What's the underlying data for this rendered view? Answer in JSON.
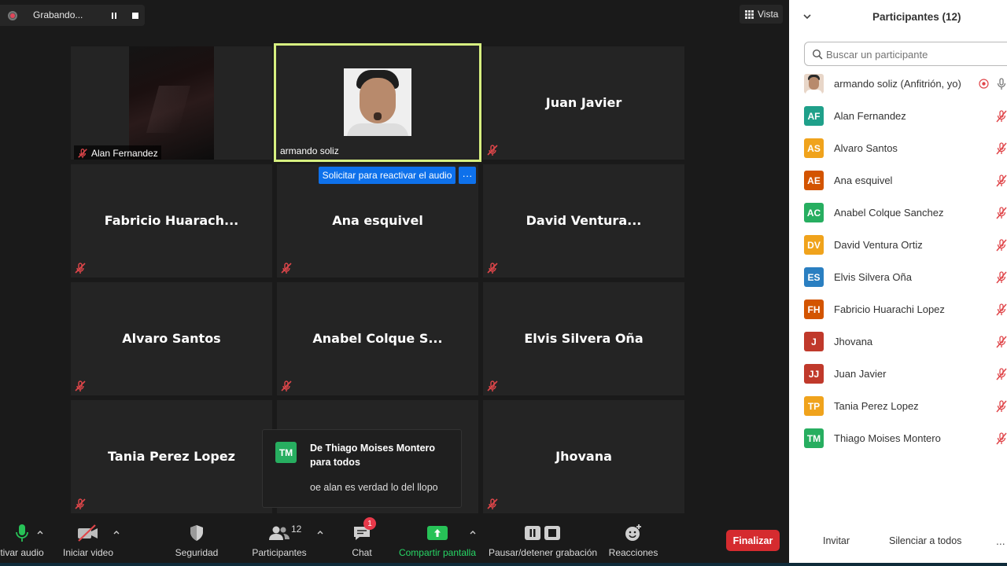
{
  "recording": {
    "label": "Grabando..."
  },
  "view_button": {
    "label": "Vista"
  },
  "tiles": [
    {
      "id": "alan",
      "name": "Alan Fernandez",
      "has_video": true
    },
    {
      "id": "armando",
      "name": "armando soliz",
      "has_video": true,
      "active_speaker": true
    },
    {
      "id": "juan",
      "name": "Juan Javier"
    },
    {
      "id": "fabricio",
      "name": "Fabricio  Huarach..."
    },
    {
      "id": "ana",
      "name": "Ana esquivel"
    },
    {
      "id": "david",
      "name": "David  Ventura..."
    },
    {
      "id": "alvaro",
      "name": "Alvaro Santos"
    },
    {
      "id": "anabel",
      "name": "Anabel  Colque  S..."
    },
    {
      "id": "elvis",
      "name": "Elvis Silvera Oña"
    },
    {
      "id": "tania",
      "name": "Tania Perez Lopez"
    },
    {
      "id": "jhovana",
      "name": "Jhovana"
    }
  ],
  "unmute_request": {
    "label": "Solicitar para reactivar el audio",
    "more_label": "···"
  },
  "chat_toast": {
    "initials": "TM",
    "from": "De Thiago Moises Montero para todos",
    "message": "oe alan es verdad lo del llopo",
    "avatar_color": "#27ae60"
  },
  "toolbar": {
    "audio_label": "tivar audio",
    "video_label": "Iniciar video",
    "security_label": "Seguridad",
    "participants_label": "Participantes",
    "participants_count": "12",
    "chat_label": "Chat",
    "chat_badge": "1",
    "share_label": "Compartir pantalla",
    "record_label": "Pausar/detener grabación",
    "reactions_label": "Reacciones",
    "end_label": "Finalizar"
  },
  "panel": {
    "title": "Participantes (12)",
    "search_placeholder": "Buscar un participante",
    "participants": [
      {
        "initials": "",
        "name": "armando soliz (Anfitrión, yo)",
        "color": "",
        "is_host": true
      },
      {
        "initials": "AF",
        "name": "Alan Fernandez",
        "color": "#1fa08a"
      },
      {
        "initials": "AS",
        "name": "Alvaro Santos",
        "color": "#f0a31c"
      },
      {
        "initials": "AE",
        "name": "Ana esquivel",
        "color": "#d35400"
      },
      {
        "initials": "AC",
        "name": "Anabel Colque Sanchez",
        "color": "#27ae60"
      },
      {
        "initials": "DV",
        "name": "David  Ventura Ortiz",
        "color": "#f0a31c"
      },
      {
        "initials": "ES",
        "name": "Elvis Silvera Oña",
        "color": "#2a7fc1"
      },
      {
        "initials": "FH",
        "name": "Fabricio Huarachi Lopez",
        "color": "#d35400"
      },
      {
        "initials": "J",
        "name": "Jhovana",
        "color": "#c0392b"
      },
      {
        "initials": "JJ",
        "name": "Juan Javier",
        "color": "#c0392b"
      },
      {
        "initials": "TP",
        "name": "Tania Perez Lopez",
        "color": "#f0a31c"
      },
      {
        "initials": "TM",
        "name": "Thiago Moises Montero",
        "color": "#27ae60"
      }
    ],
    "invite_label": "Invitar",
    "mute_all_label": "Silenciar a todos",
    "more_label": "..."
  },
  "colors": {
    "accent_blue": "#0e71eb",
    "end_red": "#d52b2f",
    "share_green": "#27c257",
    "speaker_border": "#d7f080",
    "muted_red": "#e0464a"
  }
}
